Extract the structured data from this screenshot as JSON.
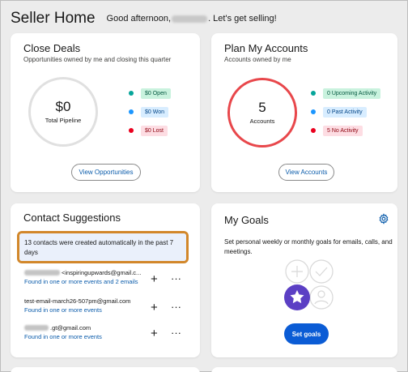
{
  "header": {
    "title": "Seller Home",
    "greeting_prefix": "Good afternoon,",
    "greeting_suffix": ". Let's get selling!"
  },
  "close_deals": {
    "title": "Close Deals",
    "subtitle": "Opportunities owned by me and closing this quarter",
    "ring_value": "$0",
    "ring_label": "Total Pipeline",
    "legend": [
      {
        "label": "$0 Open",
        "dot": "#06a59a",
        "bg": "#c9f2de",
        "fg": "#03573f"
      },
      {
        "label": "$0 Won",
        "dot": "#1b96ff",
        "bg": "#d8edff",
        "fg": "#014486"
      },
      {
        "label": "$0 Lost",
        "dot": "#ea001e",
        "bg": "#fddde3",
        "fg": "#8e030f"
      }
    ],
    "button": "View Opportunities"
  },
  "plan_accounts": {
    "title": "Plan My Accounts",
    "subtitle": "Accounts owned by me",
    "ring_value": "5",
    "ring_label": "Accounts",
    "ring_color": "#e8474b",
    "legend": [
      {
        "label": "0 Upcoming Activity",
        "dot": "#06a59a",
        "bg": "#c9f2de",
        "fg": "#03573f"
      },
      {
        "label": "0 Past Activity",
        "dot": "#1b96ff",
        "bg": "#d8edff",
        "fg": "#014486"
      },
      {
        "label": "5 No Activity",
        "dot": "#ea001e",
        "bg": "#fddde3",
        "fg": "#8e030f"
      }
    ],
    "button": "View Accounts"
  },
  "contact_suggestions": {
    "title": "Contact Suggestions",
    "notice": "13 contacts were created automatically in the past 7 days",
    "contacts": [
      {
        "email": "<inspiringupwards@gmail.c...",
        "detail": "Found in one or more events and 2 emails",
        "redacted": true
      },
      {
        "email": "test-email-march26-507pm@gmail.com",
        "detail": "Found in one or more events",
        "redacted": false
      },
      {
        "email": ".gt@gmail.com",
        "detail": "Found in one or more events",
        "redacted": true
      }
    ],
    "plus_glyph": "+",
    "more_glyph": "···"
  },
  "my_goals": {
    "title": "My Goals",
    "description": "Set personal weekly or monthly goals for emails, calls, and meetings.",
    "button": "Set goals"
  },
  "colors": {
    "brand": "#0b5cd5",
    "link": "#0b5cab",
    "highlight_border": "#d2872a",
    "goal_star_bg": "#5b3fc4"
  }
}
